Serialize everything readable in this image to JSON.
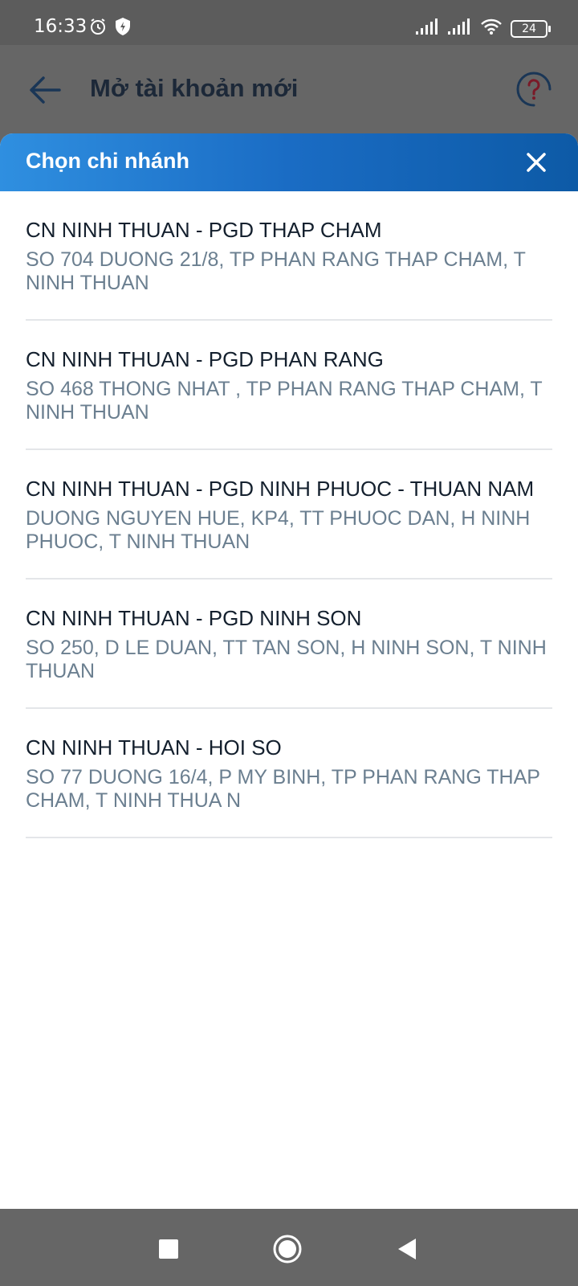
{
  "status_bar": {
    "time": "16:33",
    "battery": "24",
    "icons_left": [
      "alarm-icon",
      "shield-bolt-icon"
    ],
    "icons_right": [
      "signal-icon",
      "signal-icon",
      "wifi-icon",
      "battery-icon"
    ]
  },
  "header": {
    "title": "Mở tài khoản mới",
    "back_icon": "arrow-left-icon",
    "help_icon": "help-circle-icon"
  },
  "sheet": {
    "title": "Chọn chi nhánh",
    "close_icon": "close-icon",
    "branches": [
      {
        "name": "CN NINH THUAN - PGD THAP CHAM",
        "address": "SO 704 DUONG 21/8, TP PHAN RANG THAP CHAM, T NINH THUAN"
      },
      {
        "name": "CN NINH THUAN - PGD PHAN RANG",
        "address": "SO 468 THONG NHAT , TP PHAN RANG THAP CHAM, T NINH THUAN"
      },
      {
        "name": "CN NINH THUAN - PGD NINH PHUOC - THUAN NAM",
        "address": "DUONG NGUYEN HUE, KP4, TT PHUOC DAN, H NINH PHUOC, T NINH THUAN"
      },
      {
        "name": "CN NINH THUAN - PGD NINH SON",
        "address": "SO 250, D LE DUAN, TT TAN SON, H NINH SON, T NINH THUAN"
      },
      {
        "name": "CN NINH THUAN - HOI SO",
        "address": "SO 77 DUONG 16/4, P MY BINH, TP PHAN RANG THAP CHAM, T NINH THUA N"
      }
    ]
  },
  "nav_bar": {
    "icons": [
      "recents-square-icon",
      "home-circle-icon",
      "back-triangle-icon"
    ]
  },
  "colors": {
    "header_gradient_start": "#2f8fe0",
    "header_gradient_end": "#0d5aa6",
    "text_primary": "#14202e",
    "text_secondary": "#6b7f90",
    "help_accent": "#7a1a28"
  }
}
